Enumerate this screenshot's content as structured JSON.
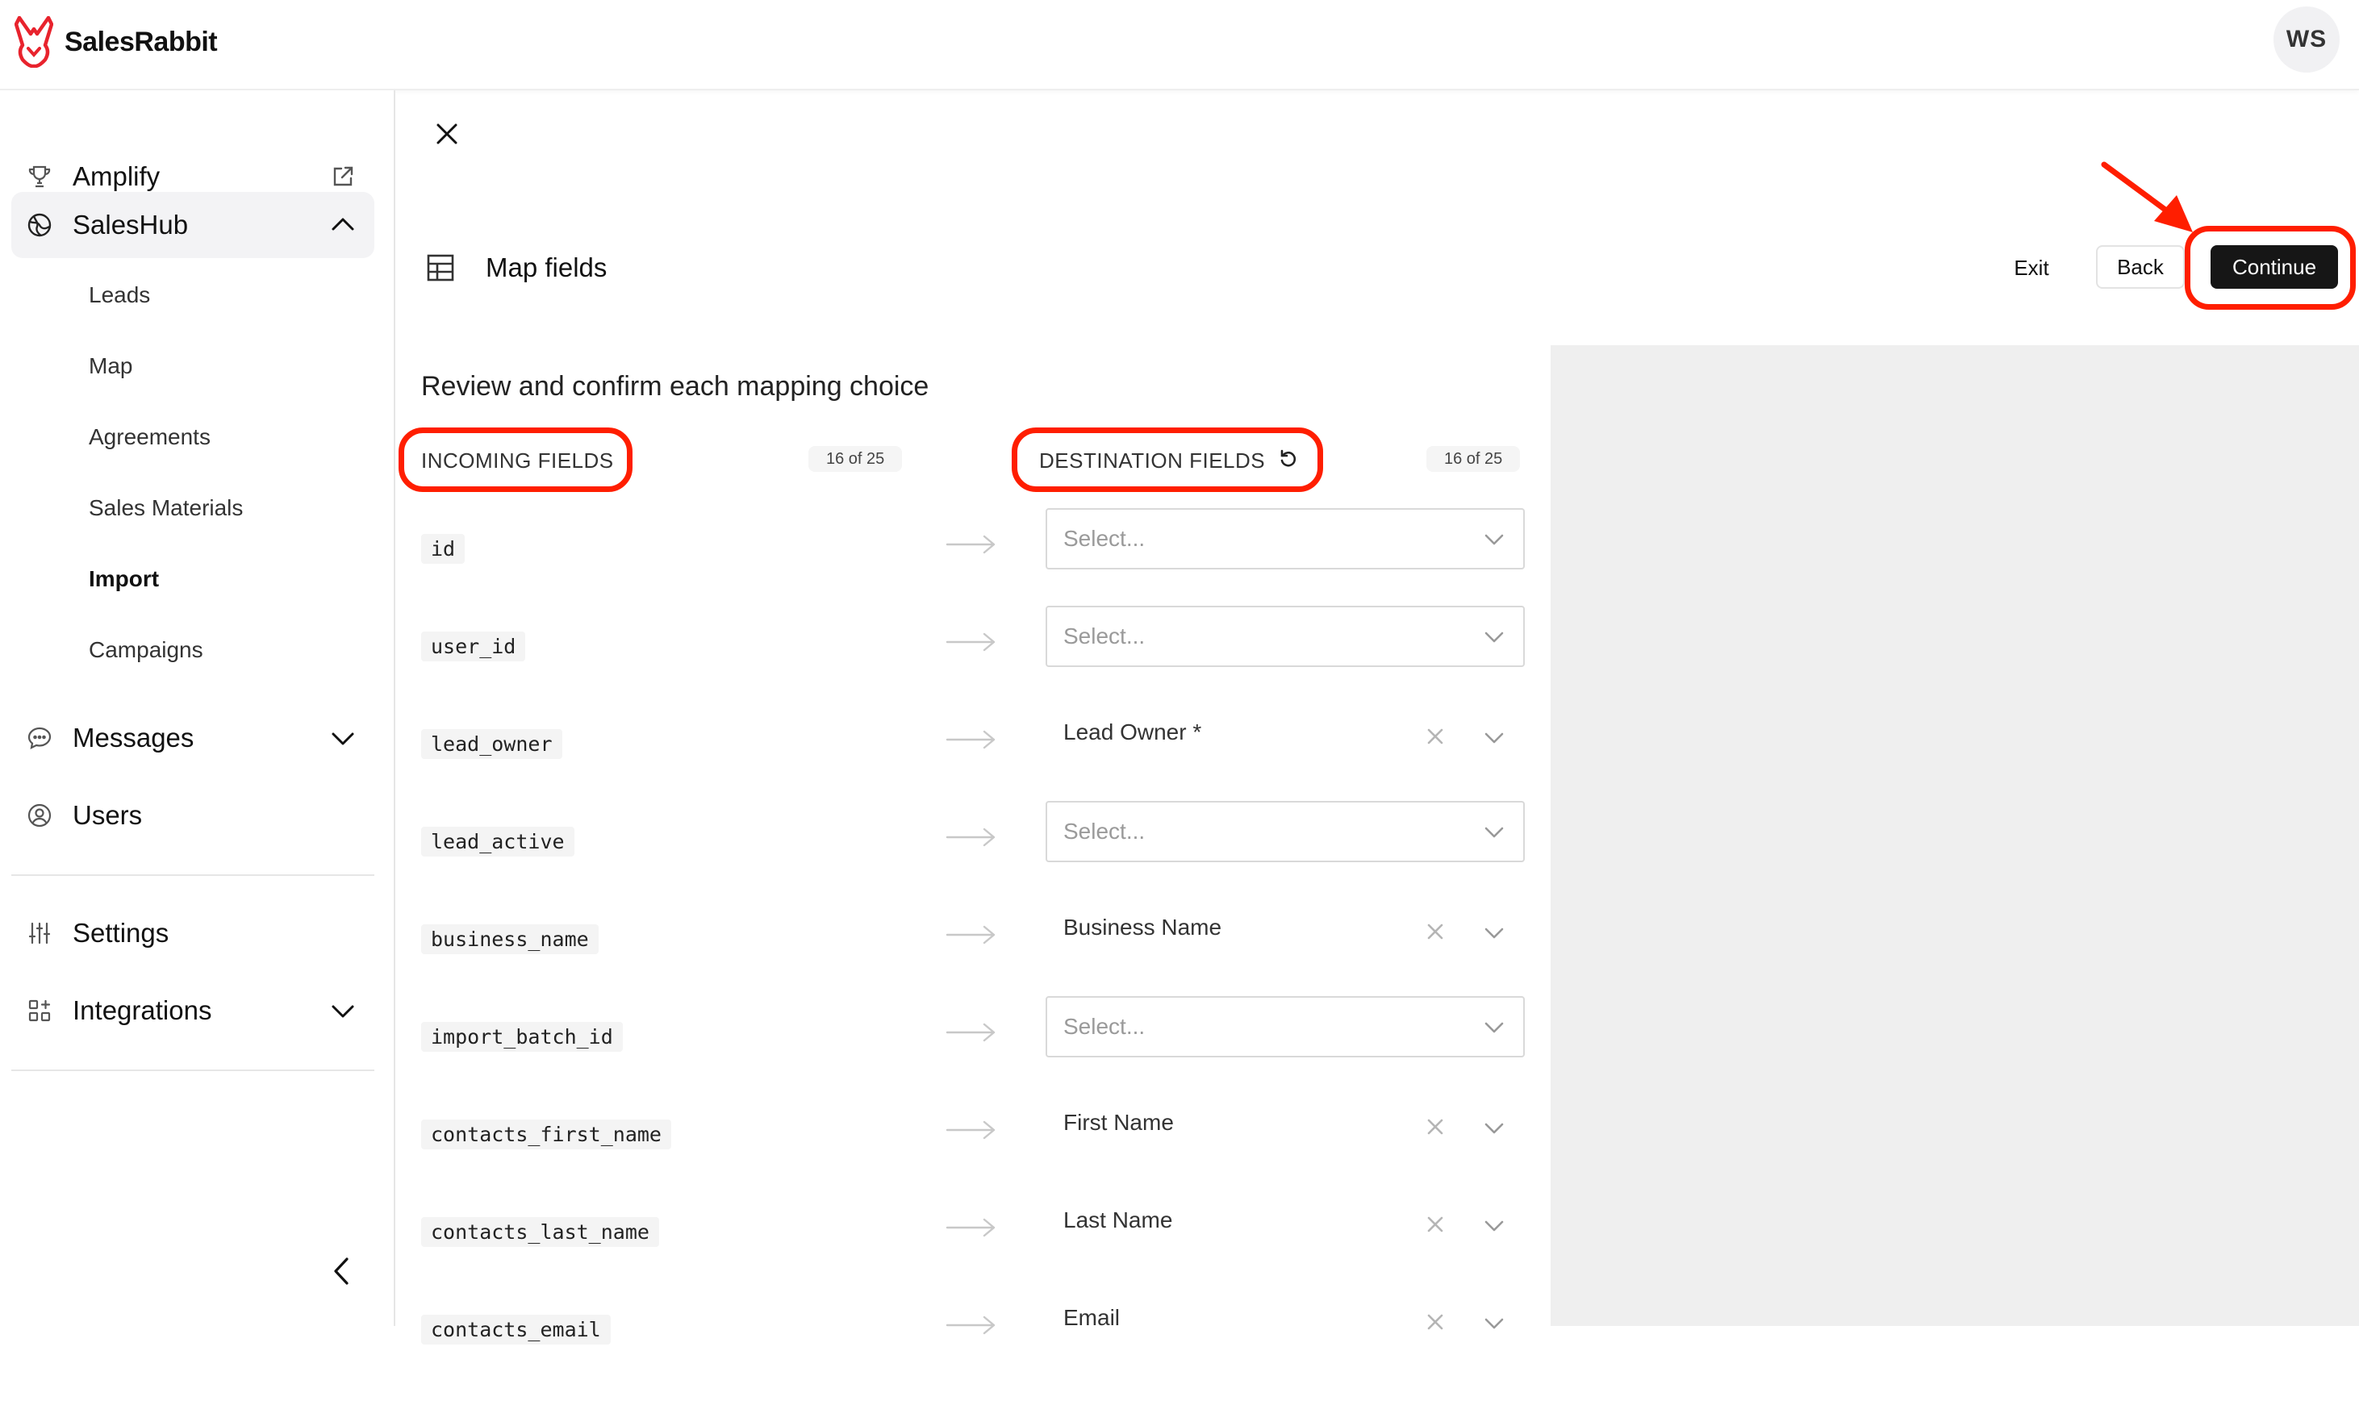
{
  "app": {
    "name": "SalesRabbit",
    "user_initials": "WS",
    "brand_color": "#e8232d"
  },
  "sidebar": {
    "items": [
      {
        "label": "Amplify",
        "icon": "trophy-icon"
      },
      {
        "label": "SalesHub",
        "icon": "globe-icon",
        "expanded": true,
        "children": [
          "Leads",
          "Map",
          "Agreements",
          "Sales Materials",
          "Import",
          "Campaigns"
        ],
        "active_child": "Import"
      },
      {
        "label": "Messages",
        "icon": "chat-icon"
      },
      {
        "label": "Users",
        "icon": "user-circle-icon"
      },
      {
        "label": "Settings",
        "icon": "sliders-icon"
      },
      {
        "label": "Integrations",
        "icon": "grid-plus-icon"
      }
    ]
  },
  "header": {
    "title": "Map fields",
    "buttons": {
      "exit": "Exit",
      "back": "Back",
      "continue": "Continue"
    }
  },
  "mapping": {
    "heading": "Review and confirm each mapping choice",
    "incoming_label": "INCOMING FIELDS",
    "incoming_count": "16 of 25",
    "destination_label": "DESTINATION FIELDS",
    "destination_count": "16 of 25",
    "select_placeholder": "Select...",
    "rows": [
      {
        "source": "id",
        "destination": ""
      },
      {
        "source": "user_id",
        "destination": ""
      },
      {
        "source": "lead_owner",
        "destination": "Lead Owner *"
      },
      {
        "source": "lead_active",
        "destination": ""
      },
      {
        "source": "business_name",
        "destination": "Business Name"
      },
      {
        "source": "import_batch_id",
        "destination": ""
      },
      {
        "source": "contacts_first_name",
        "destination": "First Name"
      },
      {
        "source": "contacts_last_name",
        "destination": "Last Name"
      },
      {
        "source": "contacts_email",
        "destination": "Email"
      }
    ]
  },
  "annotation_color": "#ff1e00"
}
